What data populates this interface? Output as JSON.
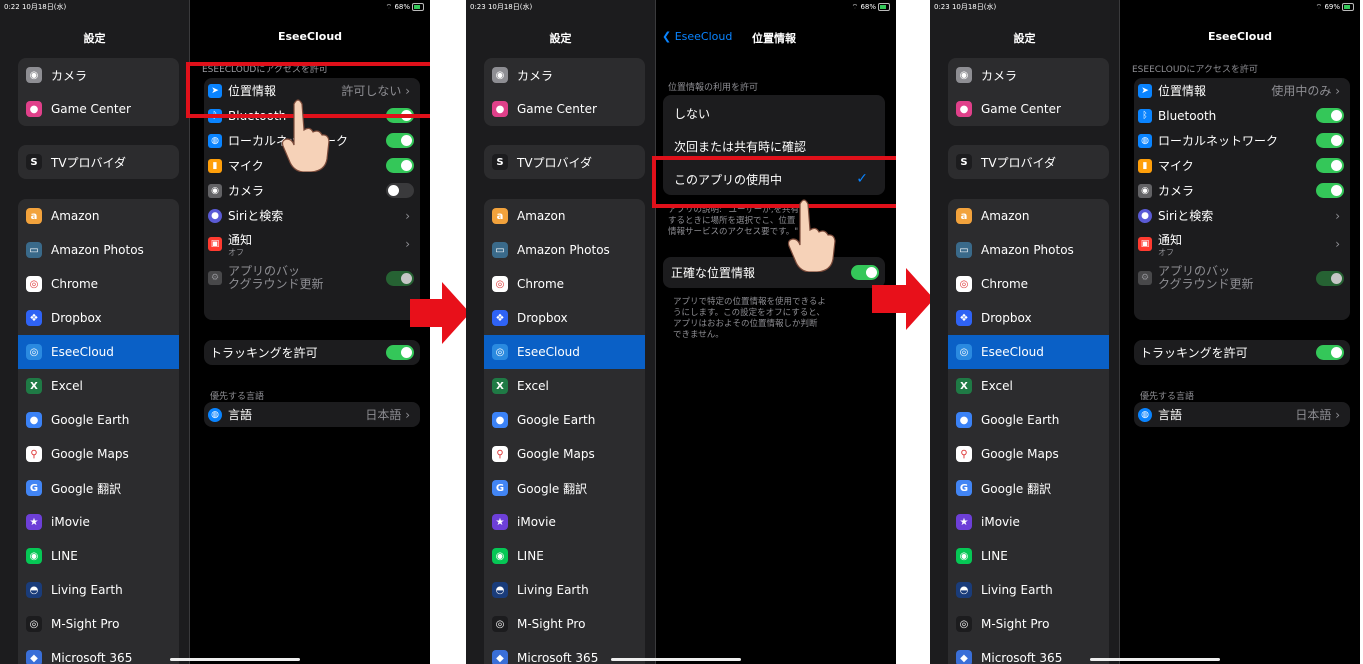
{
  "common": {
    "settings_title": "設定",
    "sidebar_items": [
      {
        "label": "カメラ",
        "icon": "camera-icon",
        "color": "#8e8e93",
        "glyph": "◉"
      },
      {
        "label": "Game Center",
        "icon": "game-center-icon",
        "color": "#e0408a",
        "glyph": "●"
      },
      {
        "label": "TVプロバイダ",
        "icon": "tv-provider-icon",
        "color": "#1c1c1e",
        "glyph": "S"
      },
      {
        "label": "Amazon",
        "icon": "amazon-icon",
        "color": "#f2a23c",
        "glyph": "a"
      },
      {
        "label": "Amazon Photos",
        "icon": "amazon-photos-icon",
        "color": "#3a6a8a",
        "glyph": "▭"
      },
      {
        "label": "Chrome",
        "icon": "chrome-icon",
        "color": "#ffffff",
        "glyph": "◎"
      },
      {
        "label": "Dropbox",
        "icon": "dropbox-icon",
        "color": "#2f63f5",
        "glyph": "❖"
      },
      {
        "label": "EseeCloud",
        "icon": "eseecloud-icon",
        "color": "#2a8ae0",
        "glyph": "◎"
      },
      {
        "label": "Excel",
        "icon": "excel-icon",
        "color": "#1f7a45",
        "glyph": "X"
      },
      {
        "label": "Google Earth",
        "icon": "google-earth-icon",
        "color": "#3b82f6",
        "glyph": "●"
      },
      {
        "label": "Google Maps",
        "icon": "google-maps-icon",
        "color": "#ffffff",
        "glyph": "⚲"
      },
      {
        "label": "Google 翻訳",
        "icon": "google-translate-icon",
        "color": "#4285f4",
        "glyph": "G"
      },
      {
        "label": "iMovie",
        "icon": "imovie-icon",
        "color": "#6d3fd8",
        "glyph": "★"
      },
      {
        "label": "LINE",
        "icon": "line-icon",
        "color": "#06c755",
        "glyph": "◉"
      },
      {
        "label": "Living Earth",
        "icon": "living-earth-icon",
        "color": "#1a3c7a",
        "glyph": "◓"
      },
      {
        "label": "M-Sight Pro",
        "icon": "m-sight-pro-icon",
        "color": "#1c1c1e",
        "glyph": "◎"
      },
      {
        "label": "Microsoft 365",
        "icon": "microsoft-365-icon",
        "color": "#3a6fd8",
        "glyph": "◆"
      }
    ]
  },
  "screen1": {
    "time": "0:22 10月18日(水)",
    "status": "68%",
    "detail_title": "EseeCloud",
    "section_header": "ESEECLOUDにアクセスを許可",
    "rows": {
      "location": {
        "label": "位置情報",
        "value": "許可しない"
      },
      "bluetooth": {
        "label": "Bluetooth"
      },
      "local_network": {
        "label": "ローカルネットワーク"
      },
      "mic": {
        "label": "マイク"
      },
      "camera": {
        "label": "カメラ"
      },
      "siri": {
        "label": "Siriと検索"
      },
      "notifications": {
        "label": "通知",
        "sub": "オフ"
      },
      "background": {
        "label": "アプリのバッ",
        "label2": "クグラウンド更新"
      }
    },
    "tracking": "トラッキングを許可",
    "language_header": "優先する言語",
    "language": {
      "label": "言語",
      "value": "日本語"
    }
  },
  "screen2": {
    "time": "0:23 10月18日(水)",
    "status": "68%",
    "back_label": "EseeCloud",
    "detail_title": "位置情報",
    "section_header": "位置情報の利用を許可",
    "options": [
      "しない",
      "次回または共有時に確認",
      "このアプリの使用中"
    ],
    "explanation": [
      "アプリの説明: \"ユーザーが",
      ",を共有",
      "するときに場所を選択で",
      "こ、位置",
      "情報サービスのアクセス",
      "要です。\""
    ],
    "precise_label": "正確な位置情報",
    "precise_note": [
      "アプリで特定の位置情報を使用できるよ",
      "うにします。この設定をオフにすると、",
      "アプリはおおよその位置情報しか判断",
      "できません。"
    ]
  },
  "screen3": {
    "time": "0:23 10月18日(水)",
    "status": "69%",
    "detail_title": "EseeCloud",
    "section_header": "ESEECLOUDにアクセスを許可",
    "rows": {
      "location": {
        "label": "位置情報",
        "value": "使用中のみ"
      },
      "bluetooth": {
        "label": "Bluetooth"
      },
      "local_network": {
        "label": "ローカルネットワーク"
      },
      "mic": {
        "label": "マイク"
      },
      "camera": {
        "label": "カメラ"
      },
      "siri": {
        "label": "Siriと検索"
      },
      "notifications": {
        "label": "通知",
        "sub": "オフ"
      },
      "background": {
        "label": "アプリのバッ",
        "label2": "クグラウンド更新"
      }
    },
    "tracking": "トラッキングを許可",
    "language_header": "優先する言語",
    "language": {
      "label": "言語",
      "value": "日本語"
    }
  },
  "colors": {
    "highlight": "#e0101a",
    "selected": "#0a60c6",
    "toggle_on": "#34c759"
  }
}
